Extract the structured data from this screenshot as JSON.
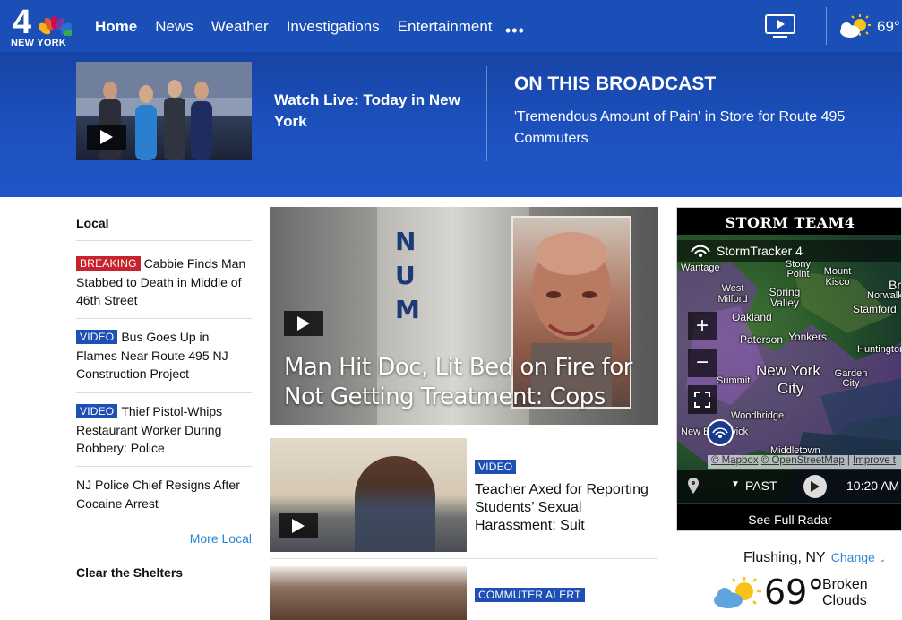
{
  "header": {
    "logo_number": "4",
    "logo_text": "NEW YORK",
    "nav": [
      "Home",
      "News",
      "Weather",
      "Investigations",
      "Entertainment"
    ],
    "more": "•••",
    "temperature": "69°"
  },
  "banner": {
    "watch_live": "Watch Live: Today in New York",
    "heading": "ON THIS BROADCAST",
    "story": "'Tremendous Amount of Pain' in Store for Route 495 Commuters"
  },
  "local": {
    "title": "Local",
    "items": [
      {
        "badge": "BREAKING",
        "text": "Cabbie Finds Man Stabbed to Death in Middle of 46th Street"
      },
      {
        "badge": "VIDEO",
        "text": "Bus Goes Up in Flames Near Route 495 NJ Construction Project"
      },
      {
        "badge": "VIDEO",
        "text": "Thief Pistol-Whips Restaurant Worker During Robbery: Police"
      },
      {
        "badge": "",
        "text": "NJ Police Chief Resigns After Cocaine Arrest"
      }
    ],
    "more": "More Local",
    "next_section": "Clear the Shelters"
  },
  "main": {
    "hero_letters": "N\nU\nM",
    "hero_headline": "Man Hit Doc, Lit Bed on Fire for Not Getting Treatment: Cops",
    "story2_badge": "VIDEO",
    "story2_title": "Teacher Axed for Reporting Students’ Sexual Harassment: Suit",
    "story3_badge": "COMMUTER ALERT"
  },
  "radar": {
    "header": "STORM TEAM",
    "header_num": "4",
    "tracker": "StormTracker 4",
    "labels": {
      "wantage": "Wantage",
      "west_milford": "West Milford",
      "stony_point": "Stony Point",
      "mount_kisco": "Mount Kisco",
      "spring_valley": "Spring Valley",
      "oakland": "Oakland",
      "stamford": "Stamford",
      "paterson": "Paterson",
      "yonkers": "Yonkers",
      "huntington": "Huntington",
      "new_york": "New York",
      "city": "City",
      "garden_city": "Garden City",
      "summit": "Summit",
      "woodbridge": "Woodbridge",
      "middletown": "Middletown",
      "new_brunswick": "New Brunswick",
      "norwalk": "Norwalk",
      "bri": "Bri"
    },
    "credit_1": "© Mapbox",
    "credit_2": "© OpenStreetMap",
    "credit_sep": " | ",
    "credit_3": "Improve t",
    "past": "PAST",
    "time": "10:20 AM",
    "see_full": "See Full Radar"
  },
  "weather": {
    "location": "Flushing, NY",
    "change": "Change",
    "temp": "69°",
    "desc": "Broken Clouds"
  }
}
